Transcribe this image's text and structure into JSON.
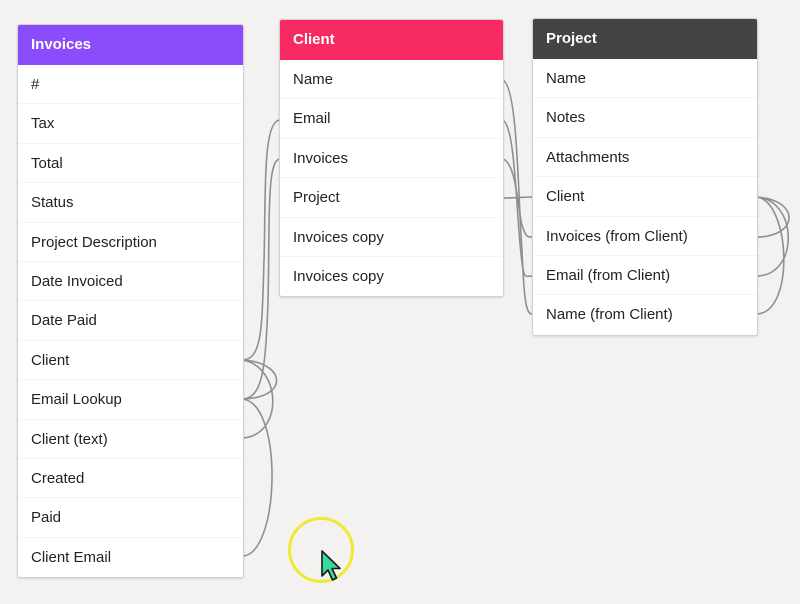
{
  "tables": [
    {
      "title": "Invoices",
      "header_color": "#8b4dfb",
      "fields": [
        "#",
        "Tax",
        "Total",
        "Status",
        "Project Description",
        "Date Invoiced",
        "Date Paid",
        "Client",
        "Email Lookup",
        "Client (text)",
        "Created",
        "Paid",
        "Client Email"
      ]
    },
    {
      "title": "Client",
      "header_color": "#f72a61",
      "fields": [
        "Name",
        "Email",
        "Invoices",
        "Project",
        "Invoices copy",
        "Invoices copy"
      ]
    },
    {
      "title": "Project",
      "header_color": "#444444",
      "fields": [
        "Name",
        "Notes",
        "Attachments",
        "Client",
        "Invoices (from Client)",
        "Email (from Client)",
        "Name (from Client)"
      ]
    }
  ],
  "colors": {
    "link_line": "#8f8f8f",
    "cursor_highlight": "#ecea32",
    "cursor_fill": "#3ad9a0"
  }
}
